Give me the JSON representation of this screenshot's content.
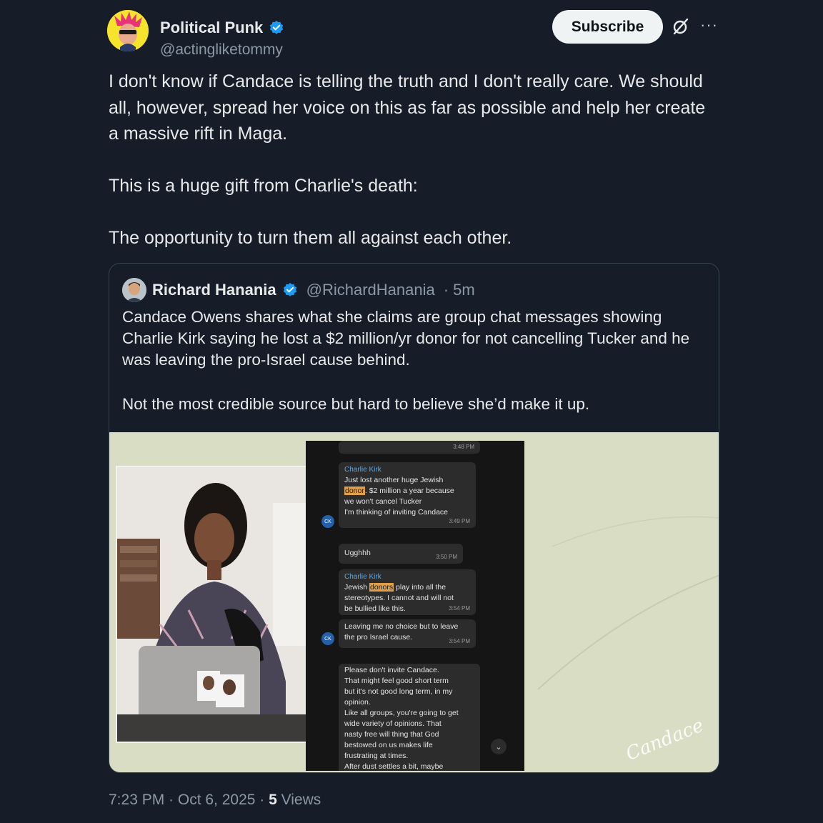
{
  "author": {
    "name": "Political Punk",
    "handle": "@actingliketommy",
    "verified": true
  },
  "actions": {
    "subscribe_label": "Subscribe",
    "grok_icon": "grok-icon",
    "more_label": "···"
  },
  "post": {
    "paragraphs": [
      "I don't know if Candace is telling the truth and I don't really care. We should all, however, spread her voice on this as far as possible and help her create a massive rift in Maga.",
      "This is a huge gift from Charlie's death:",
      "The opportunity to turn them all against each other."
    ]
  },
  "quote": {
    "name": "Richard Hanania",
    "handle": "@RichardHanania",
    "time": "· 5m",
    "paragraphs": [
      "Candace Owens shares what she claims are group chat messages showing Charlie Kirk saying he lost a $2 million/yr donor for not cancelling Tucker and he was leaving the pro-Israel cause behind.",
      "Not the most credible source but hard to believe she’d make it up."
    ]
  },
  "media": {
    "chat": {
      "top_time": "3:48 PM",
      "msg1": {
        "sender": "Charlie Kirk",
        "line1": "Just lost another huge Jewish",
        "highlight": "donor",
        "line2_rest": ". $2 million a year because",
        "line3": "we won't cancel Tucker",
        "line4": "I'm thinking of inviting Candace",
        "time": "3:49 PM"
      },
      "msg2": {
        "text": "Ugghhh",
        "time": "3:50 PM"
      },
      "msg3": {
        "sender": "Charlie Kirk",
        "pre": "Jewish ",
        "highlight": "donors",
        "post": " play into all the",
        "line2": "stereotypes. I cannot and will not",
        "line3": "be bullied like this.",
        "time": "3:54 PM"
      },
      "msg4": {
        "line1": "Leaving me no choice but to leave",
        "line2": "the pro Israel cause.",
        "time": "3:54 PM"
      },
      "msg5": {
        "lines": [
          "Please don't invite Candace.",
          "That might feel good short term",
          "but it's not good long term, in my",
          "opinion.",
          "Like all groups, you're going to get",
          "wide variety of opinions.  That",
          "nasty free will thing that God",
          "bestowed on us makes life",
          "frustrating at times.",
          "After dust settles a bit, maybe"
        ]
      },
      "avatar_initials": "CK"
    },
    "signature": "Candace"
  },
  "footer": {
    "timestamp": "7:23 PM · Oct 6, 2025 · ",
    "views_count": "5",
    "views_label": " Views"
  },
  "colors": {
    "background": "#161d28",
    "verified_blue": "#1d9bf0",
    "secondary_text": "#8b98a5",
    "media_background": "#d9ddc3"
  }
}
